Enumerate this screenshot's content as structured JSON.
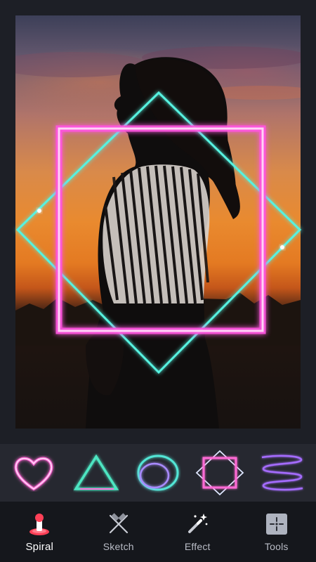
{
  "shapes": [
    {
      "name": "heart",
      "color": "#ff6ad5"
    },
    {
      "name": "triangle",
      "color": "#4de6c2"
    },
    {
      "name": "circle",
      "color": "#52e6d6"
    },
    {
      "name": "diamond-square",
      "color": "#ff6ad5"
    },
    {
      "name": "spiral-lines",
      "color": "#a56cff"
    }
  ],
  "nav": {
    "items": [
      {
        "label": "Spiral",
        "icon": "spiral-icon",
        "active": true
      },
      {
        "label": "Sketch",
        "icon": "sketch-icon",
        "active": false
      },
      {
        "label": "Effect",
        "icon": "effect-wand-icon",
        "active": false
      },
      {
        "label": "Tools",
        "icon": "tools-icon",
        "active": false
      }
    ]
  },
  "colors": {
    "neon_pink": "#ff55e0",
    "neon_cyan": "#57f2e0",
    "accent_red": "#ff4057",
    "background": "#1d1f26"
  }
}
